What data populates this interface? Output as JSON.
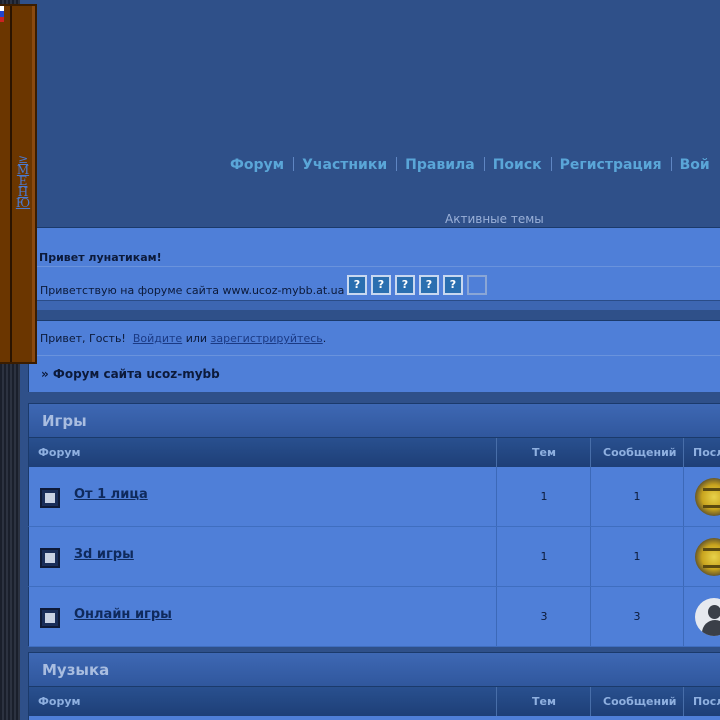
{
  "side_menu": {
    "label": "≥МЕНЮ"
  },
  "nav": {
    "items": [
      {
        "label": "Форум"
      },
      {
        "label": "Участники"
      },
      {
        "label": "Правила"
      },
      {
        "label": "Поиск"
      },
      {
        "label": "Регистрация"
      },
      {
        "label": "Вой"
      }
    ]
  },
  "active_topics": "Активные темы",
  "welcome": {
    "title": "Привет лунатикам!",
    "text": "Приветствую на форуме сайта www.ucoz-mybb.at.ua",
    "smilies": [
      "?",
      "?",
      "?",
      "?",
      "?",
      ""
    ]
  },
  "guest": {
    "prefix": "Привет, Гость!",
    "login": "Войдите",
    "or": "или",
    "register": "зарегистрируйтесь",
    "dot": "."
  },
  "breadcrumb": "» Форум сайта ucoz-mybb",
  "categories": [
    {
      "title": "Игры",
      "headers": {
        "forum": "Форум",
        "topics": "Тем",
        "posts": "Сообщений",
        "last": "Посл"
      },
      "rows": [
        {
          "title": "От 1 лица",
          "topics": "1",
          "posts": "1",
          "avatar": "gold"
        },
        {
          "title": "3d игры",
          "topics": "1",
          "posts": "1",
          "avatar": "gold"
        },
        {
          "title": "Онлайн игры",
          "topics": "3",
          "posts": "3",
          "avatar": "user"
        }
      ]
    },
    {
      "title": "Музыка",
      "headers": {
        "forum": "Форум",
        "topics": "Тем",
        "posts": "Сообщений",
        "last": "Посл"
      }
    }
  ],
  "colors": {
    "background": "#2f5089",
    "panel": "#4f7fd8",
    "nav_link": "#5aa6d8",
    "menu_tab": "#6b3600"
  }
}
